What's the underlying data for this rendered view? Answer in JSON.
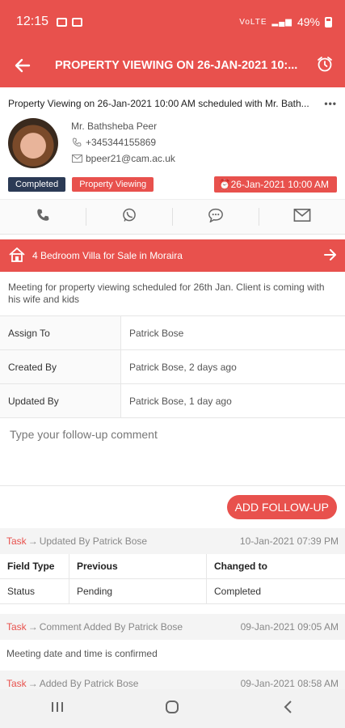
{
  "status_bar": {
    "time": "12:15",
    "network": "VoLTE",
    "battery": "49%"
  },
  "app_bar": {
    "back_icon": "arrow-left-icon",
    "title": "PROPERTY VIEWING ON 26-JAN-2021 10:...",
    "alarm_icon": "alarm-clock-icon"
  },
  "summary": {
    "text": "Property Viewing on 26-Jan-2021 10:00 AM scheduled with Mr. Bath...",
    "more": "•••"
  },
  "contact": {
    "name": "Mr. Bathsheba Peer",
    "phone": "+345344155869",
    "email": "bpeer21@cam.ac.uk"
  },
  "badges": {
    "status": "Completed",
    "type": "Property Viewing",
    "datetime": "26-Jan-2021 10:00 AM"
  },
  "actions": [
    "phone-icon",
    "whatsapp-icon",
    "sms-icon",
    "email-icon"
  ],
  "property": {
    "name": "4 Bedroom Villa for Sale in Moraira"
  },
  "description": "Meeting for property viewing scheduled for 26th Jan. Client is coming with his wife and kids",
  "details": [
    {
      "label": "Assign To",
      "value": "Patrick Bose"
    },
    {
      "label": "Created By",
      "value": "Patrick Bose, 2 days ago"
    },
    {
      "label": "Updated By",
      "value": "Patrick Bose, 1 day ago"
    }
  ],
  "followup": {
    "placeholder": "Type your follow-up comment",
    "button": "ADD FOLLOW-UP"
  },
  "logs": [
    {
      "tag": "Task",
      "arrow": "→",
      "text": "Updated By Patrick Bose",
      "when": "10-Jan-2021 07:39 PM"
    },
    {
      "tag": "Task",
      "arrow": "→",
      "text": "Comment Added By Patrick Bose",
      "when": "09-Jan-2021 09:05 AM"
    },
    {
      "tag": "Task",
      "arrow": "→",
      "text": "Added By Patrick Bose",
      "when": "09-Jan-2021 08:58 AM"
    }
  ],
  "change_table": {
    "headers": [
      "Field Type",
      "Previous",
      "Changed to"
    ],
    "rows": [
      [
        "Status",
        "Pending",
        "Completed"
      ]
    ]
  },
  "comment_log": "Meeting date and time is confirmed",
  "nav_bar": [
    "recents-icon",
    "home-icon",
    "back-icon"
  ]
}
